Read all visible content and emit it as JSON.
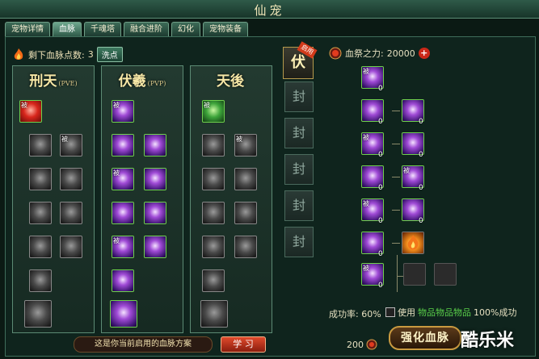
{
  "window": {
    "title": "仙宠"
  },
  "tabs": [
    {
      "label": "宠物详情"
    },
    {
      "label": "血脉",
      "active": true
    },
    {
      "label": "千魂塔"
    },
    {
      "label": "融合进阶"
    },
    {
      "label": "幻化"
    },
    {
      "label": "宠物装备"
    }
  ],
  "points": {
    "label": "剩下血脉点数:",
    "value": "3",
    "wash_button": "洗点"
  },
  "panels": [
    {
      "title": "刑天",
      "subtitle": "(PVE)"
    },
    {
      "title": "伏羲",
      "subtitle": "(PVP)"
    },
    {
      "title": "天後",
      "subtitle": ""
    }
  ],
  "side": {
    "active_label": "伏",
    "enabled_tag": "启用",
    "seals": [
      "封",
      "封",
      "封",
      "封",
      "封"
    ]
  },
  "right": {
    "power_label": "血祭之力:",
    "power_value": "20000",
    "counts": [
      "0",
      "0",
      "0",
      "0",
      "0",
      "0",
      "0",
      "0",
      "0",
      "0",
      "0"
    ],
    "success_label": "成功率:",
    "success_value": "60%",
    "use_prefix": "使用",
    "use_item": "物品物品物品",
    "use_suffix": "100%成功",
    "cost": "200",
    "strengthen_button": "强化血脉"
  },
  "bottom": {
    "plan_text": "这是你当前启用的血脉方案",
    "learn_button": "学 习"
  },
  "passive_mark": "被",
  "watermark": "酷乐米",
  "colors": {
    "accent": "#6fd04d",
    "frame": "#5c8a74",
    "background": "#0f241d"
  }
}
